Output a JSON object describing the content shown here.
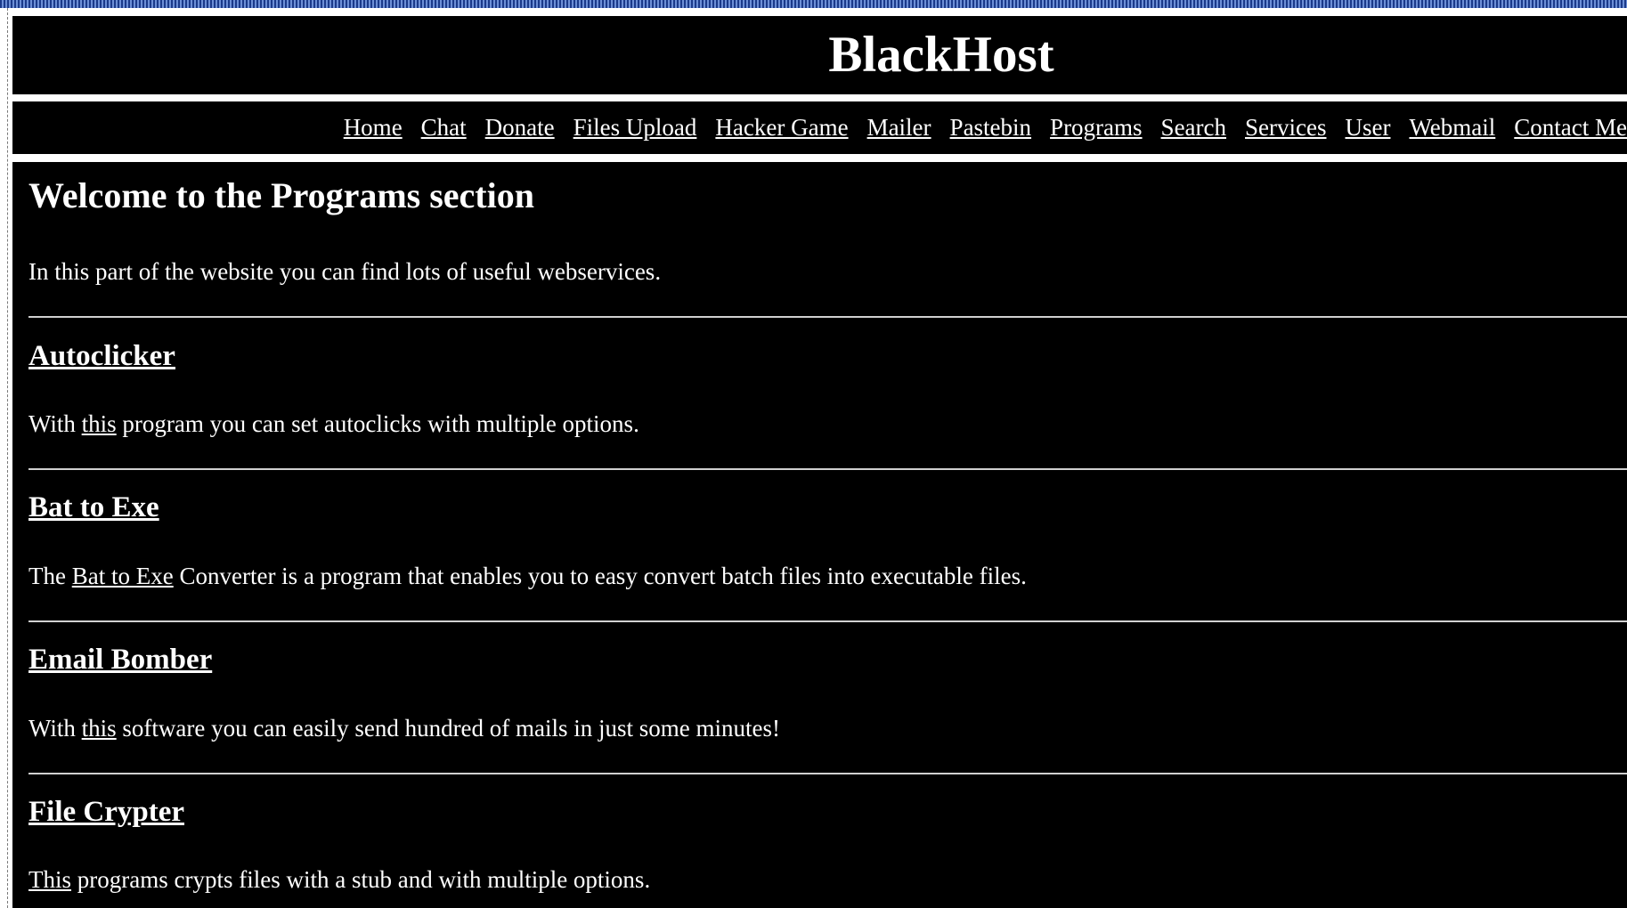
{
  "site": {
    "title": "BlackHost"
  },
  "nav": {
    "items": [
      "Home",
      "Chat",
      "Donate",
      "Files Upload",
      "Hacker Game",
      "Mailer",
      "Pastebin",
      "Programs",
      "Search",
      "Services",
      "User",
      "Webmail",
      "Contact Me"
    ]
  },
  "main": {
    "heading": "Welcome to the Programs section",
    "intro": "In this part of the website you can find lots of useful webservices.",
    "programs": [
      {
        "title": "Autoclicker",
        "desc_before": "With ",
        "desc_link": "this",
        "desc_after": " program you can set autoclicks with multiple options."
      },
      {
        "title": "Bat to Exe",
        "desc_before": "The ",
        "desc_link": "Bat to Exe",
        "desc_after": " Converter is a program that enables you to easy convert batch files into executable files."
      },
      {
        "title": "Email Bomber",
        "desc_before": "With ",
        "desc_link": "this",
        "desc_after": " software you can easily send hundred of mails in just some minutes!"
      },
      {
        "title": "File Crypter",
        "desc_before": "",
        "desc_link": "This",
        "desc_after": " programs crypts files with a stub and with multiple options."
      }
    ]
  }
}
